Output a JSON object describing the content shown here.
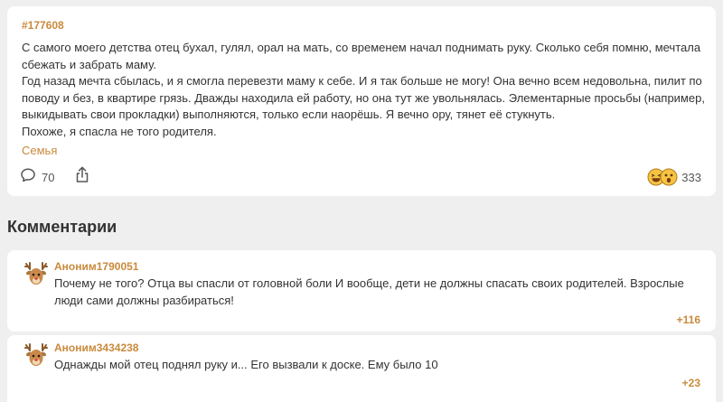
{
  "post": {
    "id": "#177608",
    "paragraphs": [
      "С самого моего детства отец бухал, гулял, орал на мать, со временем начал поднимать руку. Сколько себя помню, мечтала сбежать и забрать маму.",
      "Год назад мечта сбылась, и я смогла перевезти маму к себе. И я так больше не могу! Она вечно всем недовольна, пилит по поводу и без, в квартире грязь. Дважды находила ей работу, но она тут же увольнялась. Элементарные просьбы (например, выкидывать свои прокладки) выполняются, только если наорёшь. Я вечно ору, тянет её стукнуть.",
      "Похоже, я спасла не того родителя."
    ],
    "tag": "Семья",
    "comment_count": "70",
    "reaction_count": "333",
    "reaction_icons": [
      "laughing-emoji-icon",
      "astonished-emoji-icon"
    ]
  },
  "comments_section": {
    "heading": "Комментарии",
    "items": [
      {
        "author": "Аноним1790051",
        "text": "Почему не того? Отца вы спасли от головной боли И вообще, дети не должны спасать своих родителей. Взрослые люди сами должны разбираться!",
        "score": "+116",
        "avatar_icon": "deer-avatar-icon"
      },
      {
        "author": "Аноним3434238",
        "text": "Однажды мой отец поднял руку и... Его вызвали к доске. Ему было 10",
        "score": "+23",
        "avatar_icon": "deer-avatar-icon"
      }
    ]
  },
  "colors": {
    "page_background": "#efefef",
    "card_background": "#ffffff",
    "accent": "#c98a3c",
    "text": "#333333"
  }
}
